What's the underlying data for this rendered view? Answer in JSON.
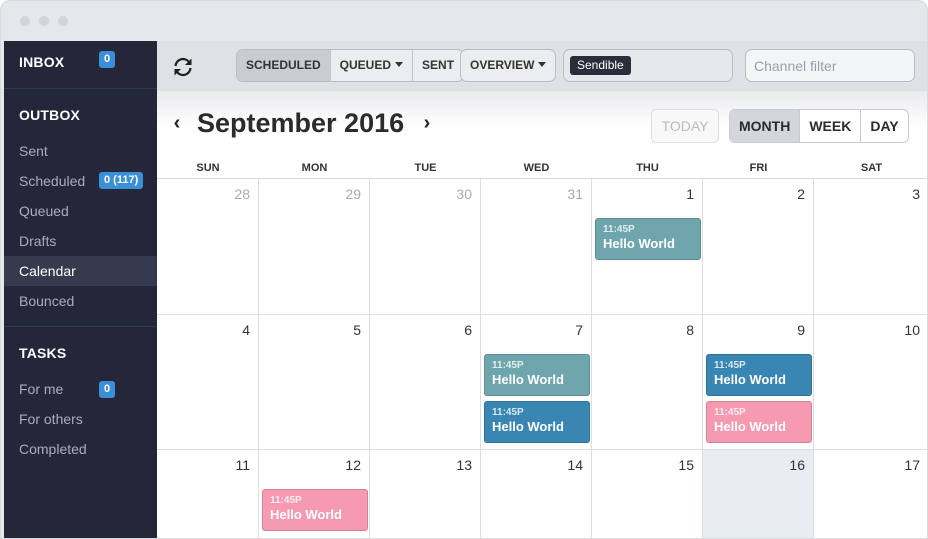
{
  "sidebar": {
    "inbox": {
      "label": "INBOX",
      "badge": "0"
    },
    "outbox": {
      "label": "OUTBOX"
    },
    "items": [
      {
        "label": "Sent"
      },
      {
        "label": "Scheduled",
        "badge": "0 (117)"
      },
      {
        "label": "Queued"
      },
      {
        "label": "Drafts"
      },
      {
        "label": "Calendar",
        "active": true
      },
      {
        "label": "Bounced"
      }
    ],
    "tasks": {
      "label": "TASKS"
    },
    "task_items": [
      {
        "label": "For me",
        "badge": "0"
      },
      {
        "label": "For others"
      },
      {
        "label": "Completed"
      }
    ]
  },
  "toolbar": {
    "refresh_icon": "refresh-icon",
    "status_tabs": [
      "SCHEDULED",
      "QUEUED",
      "SENT"
    ],
    "overview": "OVERVIEW",
    "profile_tag": "Sendible",
    "filter_placeholder": "Channel filter"
  },
  "calendar": {
    "title": "September 2016",
    "today_label": "TODAY",
    "views": [
      "MONTH",
      "WEEK",
      "DAY"
    ],
    "active_view": "MONTH",
    "weekdays": [
      "SUN",
      "MON",
      "TUE",
      "WED",
      "THU",
      "FRI",
      "SAT"
    ],
    "weeks": [
      [
        "28",
        "29",
        "30",
        "31",
        "1",
        "2",
        "3"
      ],
      [
        "4",
        "5",
        "6",
        "7",
        "8",
        "9",
        "10"
      ],
      [
        "11",
        "12",
        "13",
        "14",
        "15",
        "16",
        "17"
      ]
    ],
    "other_month_days": [
      "28",
      "29",
      "30",
      "31"
    ],
    "today_day": "16",
    "events": [
      {
        "day": "1",
        "time": "11:45P",
        "title": "Hello World",
        "color": "#6fa6ae"
      },
      {
        "day": "7",
        "time": "11:45P",
        "title": "Hello World",
        "color": "#6fa6ae"
      },
      {
        "day": "7",
        "time": "11:45P",
        "title": "Hello World",
        "color": "#3a86b3"
      },
      {
        "day": "9",
        "time": "11:45P",
        "title": "Hello World",
        "color": "#3a86b3"
      },
      {
        "day": "9",
        "time": "11:45P",
        "title": "Hello World",
        "color": "#f59ab1"
      },
      {
        "day": "12",
        "time": "11:45P",
        "title": "Hello World",
        "color": "#f59ab1"
      }
    ]
  }
}
